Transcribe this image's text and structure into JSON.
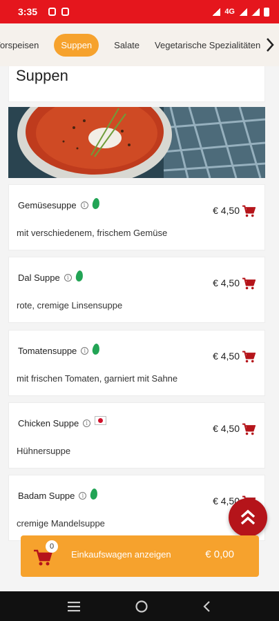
{
  "status": {
    "time": "3:35",
    "network": "4G"
  },
  "categories": [
    {
      "label": "Vorspeisen",
      "active": false
    },
    {
      "label": "Suppen",
      "active": true
    },
    {
      "label": "Salate",
      "active": false
    },
    {
      "label": "Vegetarische Spezialitäten",
      "active": false
    }
  ],
  "section": {
    "title": "Suppen"
  },
  "items": [
    {
      "name": "Gemüsesuppe",
      "badge": "leaf-icon",
      "desc": "mit verschiedenem, frischem Gemüse",
      "price": "€ 4,50"
    },
    {
      "name": "Dal Suppe",
      "badge": "leaf-icon",
      "desc": "rote, cremige Linsensuppe",
      "price": "€ 4,50"
    },
    {
      "name": "Tomatensuppe",
      "badge": "leaf-icon",
      "desc": "mit frischen Tomaten, garniert mit Sahne",
      "price": "€ 4,50"
    },
    {
      "name": "Chicken Suppe",
      "badge": "flag-icon",
      "desc": "Hühnersuppe",
      "price": "€ 4,50"
    },
    {
      "name": "Badam Suppe",
      "badge": "leaf-icon",
      "desc": "cremige Mandelsuppe",
      "price": "€ 4,50"
    }
  ],
  "cart": {
    "count": "0",
    "label": "Einkaufswagen anzeigen",
    "total": "€ 0,00"
  },
  "colors": {
    "statusbar": "#e5161d",
    "accent": "#f6a22d",
    "cart_icon": "#b5141a",
    "fab": "#b5141a",
    "leaf": "#22a455"
  }
}
